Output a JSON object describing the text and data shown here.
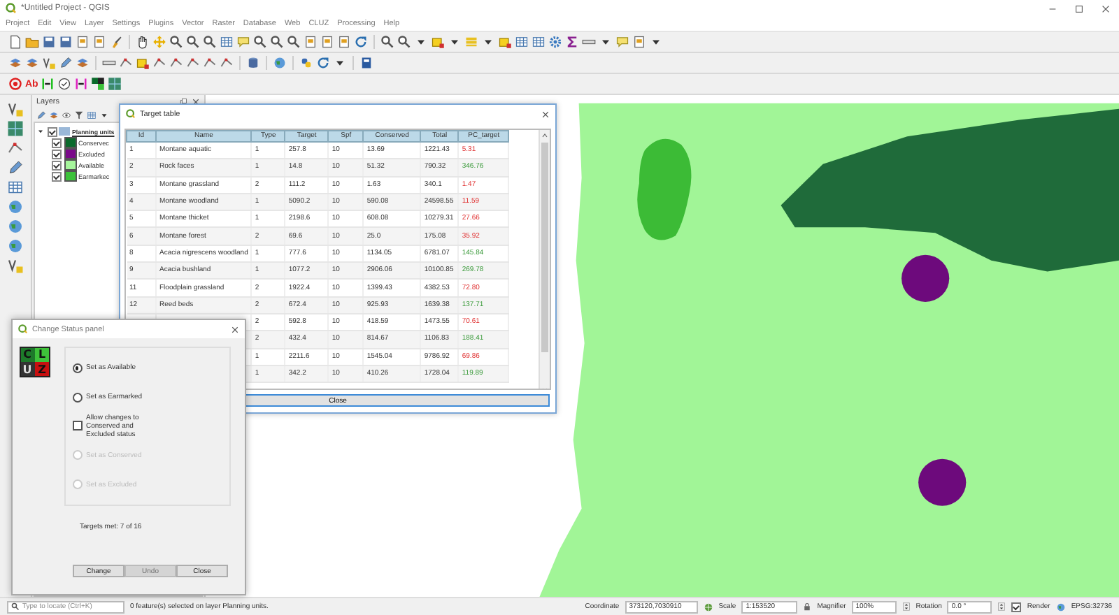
{
  "window": {
    "title": "*Untitled Project - QGIS"
  },
  "menu": [
    "Project",
    "Edit",
    "View",
    "Layer",
    "Settings",
    "Plugins",
    "Vector",
    "Raster",
    "Database",
    "Web",
    "CLUZ",
    "Processing",
    "Help"
  ],
  "toolbar_label": "Ab",
  "layers_panel": {
    "title": "Layers",
    "tree": [
      {
        "label": "Planning units",
        "checked": true,
        "expanded": true,
        "children": [
          {
            "label": "Conservec",
            "checked": true,
            "color": "#0b6a2c"
          },
          {
            "label": "Excluded",
            "checked": true,
            "color": "#7a0a8a"
          },
          {
            "label": "Available",
            "checked": true,
            "color": "#a6f59c"
          },
          {
            "label": "Earmarkec",
            "checked": true,
            "color": "#3cc23a"
          }
        ]
      }
    ]
  },
  "target_table": {
    "title": "Target table",
    "columns": [
      "Id",
      "Name",
      "Type",
      "Target",
      "Spf",
      "Conserved",
      "Total",
      "PC_target"
    ],
    "rows": [
      {
        "id": "1",
        "name": "Montane aquatic",
        "type": "1",
        "target": "257.8",
        "spf": "10",
        "conserved": "13.69",
        "total": "1221.43",
        "pc_target": "5.31",
        "met": false
      },
      {
        "id": "2",
        "name": "Rock faces",
        "type": "1",
        "target": "14.8",
        "spf": "10",
        "conserved": "51.32",
        "total": "790.32",
        "pc_target": "346.76",
        "met": true
      },
      {
        "id": "3",
        "name": "Montane grassland",
        "type": "2",
        "target": "111.2",
        "spf": "10",
        "conserved": "1.63",
        "total": "340.1",
        "pc_target": "1.47",
        "met": false
      },
      {
        "id": "4",
        "name": "Montane woodland",
        "type": "1",
        "target": "5090.2",
        "spf": "10",
        "conserved": "590.08",
        "total": "24598.55",
        "pc_target": "11.59",
        "met": false
      },
      {
        "id": "5",
        "name": "Montane thicket",
        "type": "1",
        "target": "2198.6",
        "spf": "10",
        "conserved": "608.08",
        "total": "10279.31",
        "pc_target": "27.66",
        "met": false
      },
      {
        "id": "6",
        "name": "Montane forest",
        "type": "2",
        "target": "69.6",
        "spf": "10",
        "conserved": "25.0",
        "total": "175.08",
        "pc_target": "35.92",
        "met": false
      },
      {
        "id": "8",
        "name": "Acacia nigrescens woodland",
        "type": "1",
        "target": "777.6",
        "spf": "10",
        "conserved": "1134.05",
        "total": "6781.07",
        "pc_target": "145.84",
        "met": true
      },
      {
        "id": "9",
        "name": "Acacia bushland",
        "type": "1",
        "target": "1077.2",
        "spf": "10",
        "conserved": "2906.06",
        "total": "10100.85",
        "pc_target": "269.78",
        "met": true
      },
      {
        "id": "11",
        "name": "Floodplain grassland",
        "type": "2",
        "target": "1922.4",
        "spf": "10",
        "conserved": "1399.43",
        "total": "4382.53",
        "pc_target": "72.80",
        "met": false
      },
      {
        "id": "12",
        "name": "Reed beds",
        "type": "2",
        "target": "672.4",
        "spf": "10",
        "conserved": "925.93",
        "total": "1639.38",
        "pc_target": "137.71",
        "met": true
      },
      {
        "type": "2",
        "target": "592.8",
        "spf": "10",
        "conserved": "418.59",
        "total": "1473.55",
        "pc_target": "70.61",
        "met": false
      },
      {
        "type": "2",
        "target": "432.4",
        "spf": "10",
        "conserved": "814.67",
        "total": "1106.83",
        "pc_target": "188.41",
        "met": true
      },
      {
        "type": "1",
        "target": "2211.6",
        "spf": "10",
        "conserved": "1545.04",
        "total": "9786.92",
        "pc_target": "69.86",
        "met": false
      },
      {
        "type": "1",
        "target": "342.2",
        "spf": "10",
        "conserved": "410.26",
        "total": "1728.04",
        "pc_target": "119.89",
        "met": true
      }
    ],
    "close_button": "Close"
  },
  "change_status_panel": {
    "title": "Change Status panel",
    "logo": [
      "C",
      "L",
      "U",
      "Z"
    ],
    "options": [
      {
        "kind": "radio",
        "label": "Set as Available",
        "selected": true,
        "disabled": false
      },
      {
        "kind": "radio",
        "label": "Set as Earmarked",
        "selected": false,
        "disabled": false
      },
      {
        "kind": "checkbox",
        "label": "Allow changes to Conserved and Excluded status",
        "checked": false,
        "disabled": false
      },
      {
        "kind": "radio",
        "label": "Set as Conserved",
        "selected": false,
        "disabled": true
      },
      {
        "kind": "radio",
        "label": "Set as Excluded",
        "selected": false,
        "disabled": true
      }
    ],
    "targets_met": "Targets met: 7 of 16",
    "buttons": [
      {
        "label": "Change",
        "disabled": false
      },
      {
        "label": "Undo",
        "disabled": true
      },
      {
        "label": "Close",
        "disabled": false
      }
    ]
  },
  "status_bar": {
    "search_placeholder": "Type to locate (Ctrl+K)",
    "message": "0 feature(s) selected on layer Planning units.",
    "coordinate_label": "Coordinate",
    "coordinate": "373120,7030910",
    "scale_label": "Scale",
    "scale": "1:153520",
    "magnifier_label": "Magnifier",
    "magnifier": "100%",
    "rotation_label": "Rotation",
    "rotation": "0.0 °",
    "render": {
      "label": "Render",
      "checked": true
    },
    "crs": "EPSG:32736"
  }
}
